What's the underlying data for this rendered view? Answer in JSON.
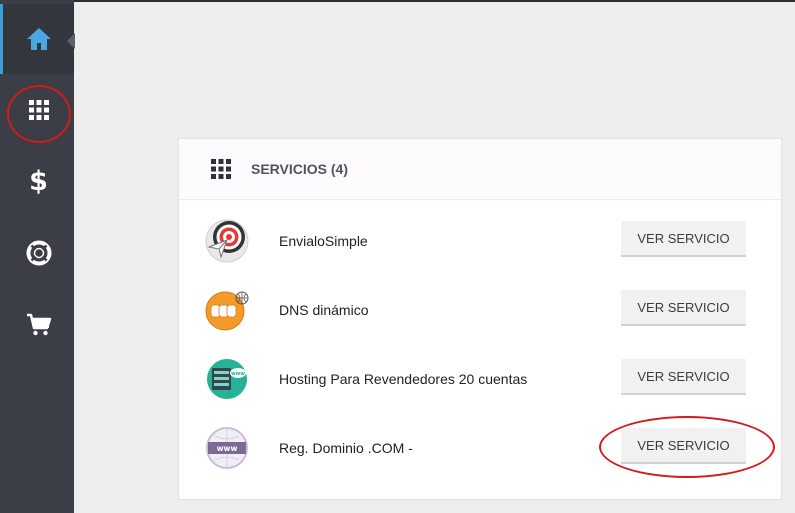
{
  "sidebar": {
    "items": [
      {
        "icon": "home-icon",
        "active": true
      },
      {
        "icon": "grid-icon",
        "active": false
      },
      {
        "icon": "dollar-icon",
        "glyph": "$"
      },
      {
        "icon": "lifebuoy-icon"
      },
      {
        "icon": "cart-icon"
      }
    ]
  },
  "panel": {
    "title": "SERVICIOS (4)",
    "icon": "grid-icon",
    "services": [
      {
        "name": "EnvialoSimple",
        "button": "VER SERVICIO",
        "icon": "target-icon"
      },
      {
        "name": "DNS dinámico",
        "button": "VER SERVICIO",
        "icon": "ddns-icon"
      },
      {
        "name": "Hosting Para Revendedores 20 cuentas",
        "button": "VER SERVICIO",
        "icon": "server-icon"
      },
      {
        "name": "Reg. Dominio .COM -",
        "button": "VER SERVICIO",
        "icon": "www-icon"
      }
    ]
  },
  "colors": {
    "sidebar_bg": "#3b3e46",
    "active_accent": "#3ba0d9",
    "home_icon": "#4aa8e0",
    "annotation_red": "#d51a1a"
  }
}
